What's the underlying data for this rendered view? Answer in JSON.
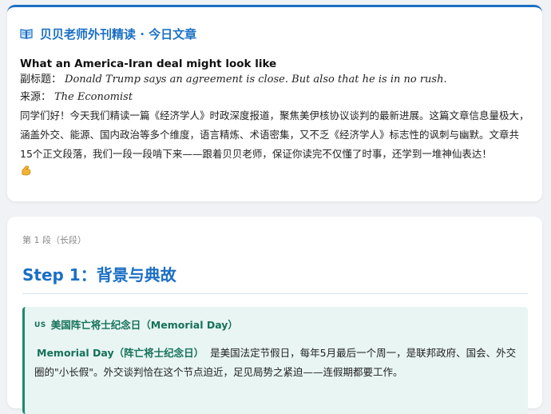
{
  "intro": {
    "title": "贝贝老师外刊精读 · 今日文章",
    "article_title": "What an America-Iran deal might look like",
    "subtitle_label": "副标题：",
    "subtitle_value": "Donald Trump says an agreement is close. But also that he is in no rush.",
    "source_label": "来源：",
    "source_value": "The Economist",
    "paragraph": "同学们好！今天我们精读一篇《经济学人》时政深度报道，聚焦美伊核协议谈判的最新进展。这篇文章信息量极大，涵盖外交、能源、国内政治等多个维度，语言精炼、术语密集，又不乏《经济学人》标志性的讽刺与幽默。文章共15个正文段落，我们一段一段啃下来——跟着贝贝老师，保证你读完不仅懂了时事，还学到一堆神仙表达！"
  },
  "lesson": {
    "section_label": "第 1 段（长段）",
    "step_heading": "Step 1：背景与典故",
    "callout": {
      "flag": "US",
      "title": "美国阵亡将士纪念日（Memorial Day）",
      "term": "Memorial Day（阵亡将士纪念日）",
      "body": "是美国法定节假日，每年5月最后一个周一，是联邦政府、国会、外交圈的\"小长假\"。外交谈判恰在这个节点迫近，足见局势之紧迫——连假期都要工作。"
    }
  },
  "colors": {
    "accent": "#1a6fc4",
    "callout_accent": "#15715a",
    "callout_bg": "#e8f5f2"
  },
  "icons": {
    "title_icon": "open-book-icon",
    "end_icon": "flexed-biceps-icon"
  }
}
